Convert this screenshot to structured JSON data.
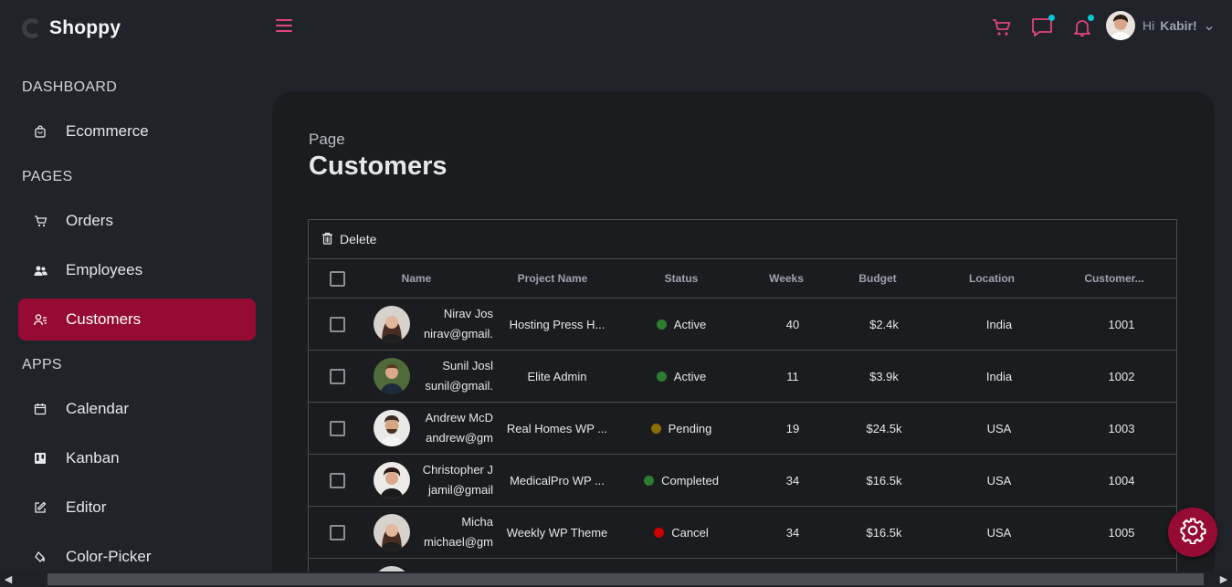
{
  "app": {
    "name": "Shoppy"
  },
  "sidebar": {
    "sections": [
      {
        "title": "DASHBOARD",
        "items": [
          {
            "label": "Ecommerce",
            "icon": "shopping-bag-icon"
          }
        ]
      },
      {
        "title": "PAGES",
        "items": [
          {
            "label": "Orders",
            "icon": "cart-icon"
          },
          {
            "label": "Employees",
            "icon": "employees-icon"
          },
          {
            "label": "Customers",
            "icon": "customers-icon",
            "active": true
          }
        ]
      },
      {
        "title": "APPS",
        "items": [
          {
            "label": "Calendar",
            "icon": "calendar-icon"
          },
          {
            "label": "Kanban",
            "icon": "kanban-icon"
          },
          {
            "label": "Editor",
            "icon": "editor-icon"
          },
          {
            "label": "Color-Picker",
            "icon": "color-picker-icon"
          }
        ]
      }
    ]
  },
  "topbar": {
    "menu_icon": "hamburger-icon",
    "icons": [
      "cart-icon",
      "chat-icon",
      "bell-icon"
    ],
    "user": {
      "greeting": "Hi",
      "name": "Kabir!"
    }
  },
  "page": {
    "label": "Page",
    "title": "Customers"
  },
  "grid": {
    "toolbar": {
      "delete_label": "Delete"
    },
    "columns": [
      "Name",
      "Project Name",
      "Status",
      "Weeks",
      "Budget",
      "Location",
      "Customer..."
    ],
    "rows": [
      {
        "name": "Nirav Jos",
        "email": "nirav@gmail.",
        "project": "Hosting Press H...",
        "status": "Active",
        "status_color": "#2f7d32",
        "weeks": "40",
        "budget": "$2.4k",
        "location": "India",
        "id": "1001"
      },
      {
        "name": "Sunil Josl",
        "email": "sunil@gmail.",
        "project": "Elite Admin",
        "status": "Active",
        "status_color": "#2f7d32",
        "weeks": "11",
        "budget": "$3.9k",
        "location": "India",
        "id": "1002"
      },
      {
        "name": "Andrew McD",
        "email": "andrew@gm",
        "project": "Real Homes WP ...",
        "status": "Pending",
        "status_color": "#8c6d00",
        "weeks": "19",
        "budget": "$24.5k",
        "location": "USA",
        "id": "1003"
      },
      {
        "name": "Christopher J",
        "email": "jamil@gmail",
        "project": "MedicalPro WP ...",
        "status": "Completed",
        "status_color": "#2f7d32",
        "weeks": "34",
        "budget": "$16.5k",
        "location": "USA",
        "id": "1004"
      },
      {
        "name": "Micha",
        "email": "michael@gm",
        "project": "Weekly WP Theme",
        "status": "Cancel",
        "status_color": "#d10000",
        "weeks": "34",
        "budget": "$16.5k",
        "location": "USA",
        "id": "1005"
      }
    ]
  },
  "colors": {
    "accent": "#960b33",
    "accent_icon": "#e0457b",
    "notification_dot": "#03c9d7"
  }
}
